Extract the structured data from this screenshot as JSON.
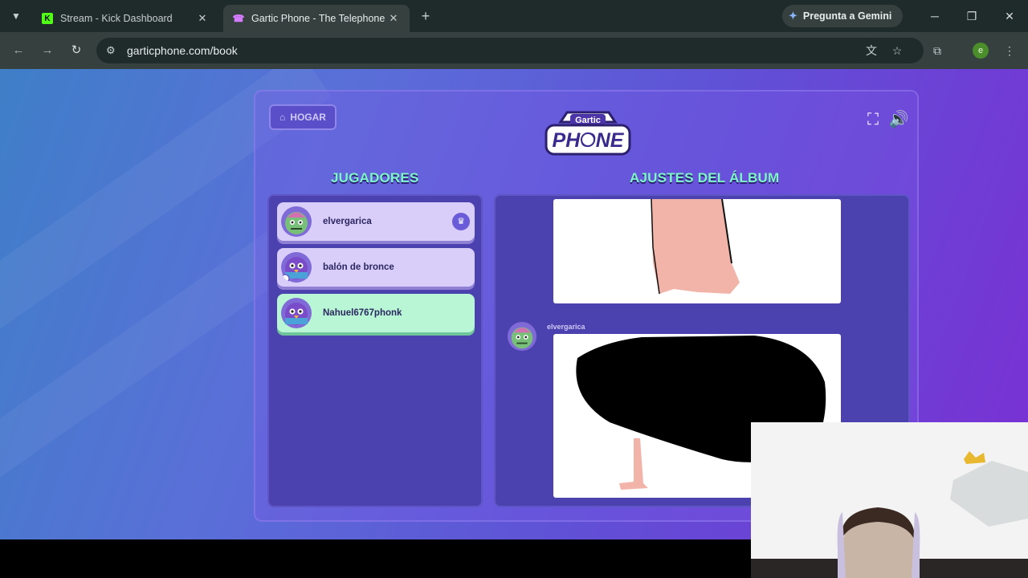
{
  "browser": {
    "tabs": [
      {
        "title": "Stream - Kick Dashboard",
        "favicon": "kick-icon",
        "active": false
      },
      {
        "title": "Gartic Phone - The Telephone G",
        "favicon": "gartic-phone-icon",
        "active": true
      }
    ],
    "gemini_label": "Pregunta a Gemini",
    "url": "garticphone.com/book",
    "profile_initial": "e"
  },
  "game": {
    "home_label": "HOGAR",
    "logo_top": "Gartic",
    "logo_main": "PHONE",
    "players_title": "JUGADORES",
    "album_title": "AJUSTES DEL ÁLBUM",
    "players": [
      {
        "name": "elvergarica",
        "host": true,
        "avatar": "green-zombie-avatar"
      },
      {
        "name": "balón de bronce",
        "host": false,
        "avatar": "purple-bird-avatar"
      },
      {
        "name": "Nahuel6767phonk",
        "host": false,
        "avatar": "purple-bird-avatar",
        "is_me": true
      }
    ],
    "album": {
      "entry_author": "elvergarica"
    }
  },
  "colors": {
    "accent_green": "#7df6c6",
    "panel": "#4b42b0",
    "page_gradient_start": "#3f7fc8",
    "page_gradient_end": "#7a2fd4"
  }
}
